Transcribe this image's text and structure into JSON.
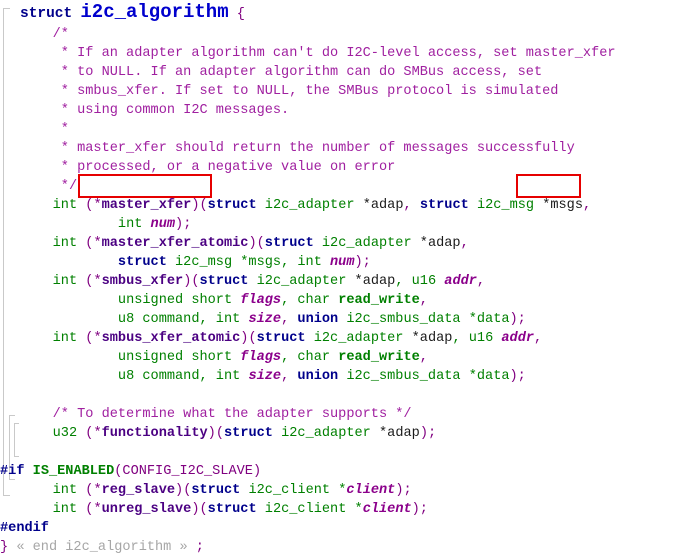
{
  "document": {
    "kind": "source-code-snippet",
    "language": "C",
    "struct_name": "i2c_algorithm",
    "background_color": "#ffffff"
  },
  "theme": {
    "keyword_color": "#00008b",
    "type_color": "#008000",
    "function_color": "#4b0082",
    "variable_color": "#8b008b",
    "comment_color": "#a020a0",
    "punctuation_color": "#800080",
    "fold_note_color": "#a6a6a6",
    "struct_name_color": "#0000cd",
    "annotation_box_color": "#e60000"
  },
  "code": {
    "line_01": {
      "kw": "struct",
      "name": "i2c_algorithm",
      "brace": "{"
    },
    "line_02": "/*",
    "line_03": " * If an adapter algorithm can't do I2C-level access, set master_xfer",
    "line_04": " * to NULL. If an adapter algorithm can do SMBus access, set",
    "line_05": " * smbus_xfer. If set to NULL, the SMBus protocol is simulated",
    "line_06": " * using common I2C messages.",
    "line_07": " *",
    "line_08": " * master_xfer should return the number of messages successfully",
    "line_09": " * processed, or a negative value on error",
    "line_10": " */",
    "line_11": {
      "t1": "int ",
      "t2": "(*",
      "t3": "master_xfer",
      "t4": ")(",
      "t5": "struct",
      "t6": " i2c_adapter ",
      "t7": "*adap",
      "t8": ", ",
      "t9": "struct",
      "t10": " ",
      "t11": "i2c_msg",
      "t12": " *msgs",
      "t13": ","
    },
    "line_12": {
      "t1": "int ",
      "t2": "num",
      "t3": ");"
    },
    "line_13": {
      "t1": "int ",
      "t2": "(*",
      "t3": "master_xfer_atomic",
      "t4": ")(",
      "t5": "struct",
      "t6": " i2c_adapter ",
      "t7": "*adap",
      "t8": ","
    },
    "line_14": {
      "t1": "struct",
      "t2": " i2c_msg *msgs, int ",
      "t3": "num",
      "t4": ");"
    },
    "line_15": {
      "t1": "int ",
      "t2": "(*",
      "t3": "smbus_xfer",
      "t4": ")(",
      "t5": "struct",
      "t6": " i2c_adapter ",
      "t7": "*adap",
      "t8": ", u16 ",
      "t9": "addr",
      "t10": ","
    },
    "line_16": {
      "t1": "unsigned short ",
      "t2": "flags",
      "t3": ", char ",
      "t4": "read_write",
      "t5": ","
    },
    "line_17": {
      "t1": "u8 command, int ",
      "t2": "size",
      "t3": ", ",
      "t4": "union",
      "t5": " i2c_smbus_data *data",
      "t6": ");"
    },
    "line_18": {
      "t1": "int ",
      "t2": "(*",
      "t3": "smbus_xfer_atomic",
      "t4": ")(",
      "t5": "struct",
      "t6": " i2c_adapter ",
      "t7": "*adap",
      "t8": ", u16 ",
      "t9": "addr",
      "t10": ","
    },
    "line_19": {
      "t1": "unsigned short ",
      "t2": "flags",
      "t3": ", char ",
      "t4": "read_write",
      "t5": ","
    },
    "line_20": {
      "t1": "u8 command, int ",
      "t2": "size",
      "t3": ", ",
      "t4": "union",
      "t5": " i2c_smbus_data *data",
      "t6": ");"
    },
    "line_21": "",
    "line_22": "/* To determine what the adapter supports */",
    "line_23": {
      "t1": "u32 ",
      "t2": "(*",
      "t3": "functionality",
      "t4": ")(",
      "t5": "struct",
      "t6": " i2c_adapter ",
      "t7": "*adap",
      "t8": ");"
    },
    "line_24": "",
    "line_25": {
      "t1": "#if",
      "t2": " ",
      "t3": "IS_ENABLED",
      "t4": "(",
      "t5": "CONFIG_I2C_SLAVE",
      "t6": ")"
    },
    "line_26": {
      "t1": "int ",
      "t2": "(*",
      "t3": "reg_slave",
      "t4": ")(",
      "t5": "struct",
      "t6": " i2c_client *",
      "t7": "client",
      "t8": ");"
    },
    "line_27": {
      "t1": "int ",
      "t2": "(*",
      "t3": "unreg_slave",
      "t4": ")(",
      "t5": "struct",
      "t6": " i2c_client *",
      "t7": "client",
      "t8": ");"
    },
    "line_28": "#endif",
    "line_29": {
      "t1": "}",
      "t2": " « end i2c_algorithm » ",
      "t3": ";"
    }
  },
  "annotations": {
    "box_1": {
      "label": "(*master_xfer)",
      "color": "#e60000"
    },
    "box_2": {
      "label": "i2c_msg",
      "color": "#e60000"
    }
  }
}
